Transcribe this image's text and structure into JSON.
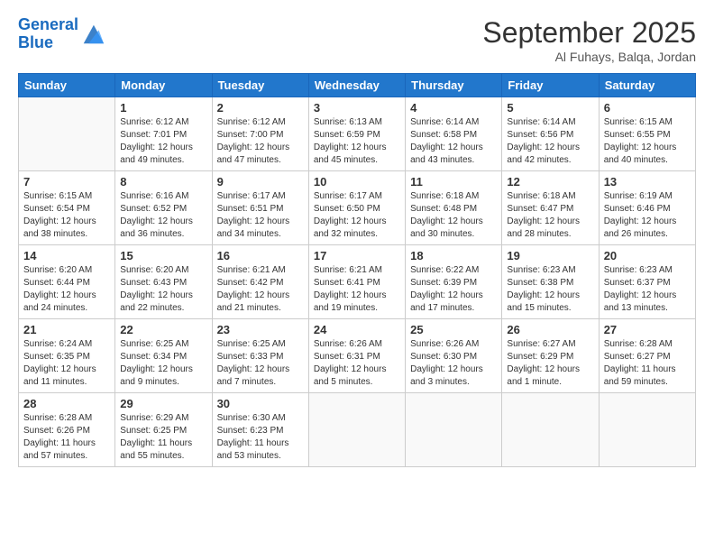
{
  "header": {
    "logo_line1": "General",
    "logo_line2": "Blue",
    "month_title": "September 2025",
    "location": "Al Fuhays, Balqa, Jordan"
  },
  "days_of_week": [
    "Sunday",
    "Monday",
    "Tuesday",
    "Wednesday",
    "Thursday",
    "Friday",
    "Saturday"
  ],
  "weeks": [
    [
      {
        "day": "",
        "info": ""
      },
      {
        "day": "1",
        "info": "Sunrise: 6:12 AM\nSunset: 7:01 PM\nDaylight: 12 hours\nand 49 minutes."
      },
      {
        "day": "2",
        "info": "Sunrise: 6:12 AM\nSunset: 7:00 PM\nDaylight: 12 hours\nand 47 minutes."
      },
      {
        "day": "3",
        "info": "Sunrise: 6:13 AM\nSunset: 6:59 PM\nDaylight: 12 hours\nand 45 minutes."
      },
      {
        "day": "4",
        "info": "Sunrise: 6:14 AM\nSunset: 6:58 PM\nDaylight: 12 hours\nand 43 minutes."
      },
      {
        "day": "5",
        "info": "Sunrise: 6:14 AM\nSunset: 6:56 PM\nDaylight: 12 hours\nand 42 minutes."
      },
      {
        "day": "6",
        "info": "Sunrise: 6:15 AM\nSunset: 6:55 PM\nDaylight: 12 hours\nand 40 minutes."
      }
    ],
    [
      {
        "day": "7",
        "info": "Sunrise: 6:15 AM\nSunset: 6:54 PM\nDaylight: 12 hours\nand 38 minutes."
      },
      {
        "day": "8",
        "info": "Sunrise: 6:16 AM\nSunset: 6:52 PM\nDaylight: 12 hours\nand 36 minutes."
      },
      {
        "day": "9",
        "info": "Sunrise: 6:17 AM\nSunset: 6:51 PM\nDaylight: 12 hours\nand 34 minutes."
      },
      {
        "day": "10",
        "info": "Sunrise: 6:17 AM\nSunset: 6:50 PM\nDaylight: 12 hours\nand 32 minutes."
      },
      {
        "day": "11",
        "info": "Sunrise: 6:18 AM\nSunset: 6:48 PM\nDaylight: 12 hours\nand 30 minutes."
      },
      {
        "day": "12",
        "info": "Sunrise: 6:18 AM\nSunset: 6:47 PM\nDaylight: 12 hours\nand 28 minutes."
      },
      {
        "day": "13",
        "info": "Sunrise: 6:19 AM\nSunset: 6:46 PM\nDaylight: 12 hours\nand 26 minutes."
      }
    ],
    [
      {
        "day": "14",
        "info": "Sunrise: 6:20 AM\nSunset: 6:44 PM\nDaylight: 12 hours\nand 24 minutes."
      },
      {
        "day": "15",
        "info": "Sunrise: 6:20 AM\nSunset: 6:43 PM\nDaylight: 12 hours\nand 22 minutes."
      },
      {
        "day": "16",
        "info": "Sunrise: 6:21 AM\nSunset: 6:42 PM\nDaylight: 12 hours\nand 21 minutes."
      },
      {
        "day": "17",
        "info": "Sunrise: 6:21 AM\nSunset: 6:41 PM\nDaylight: 12 hours\nand 19 minutes."
      },
      {
        "day": "18",
        "info": "Sunrise: 6:22 AM\nSunset: 6:39 PM\nDaylight: 12 hours\nand 17 minutes."
      },
      {
        "day": "19",
        "info": "Sunrise: 6:23 AM\nSunset: 6:38 PM\nDaylight: 12 hours\nand 15 minutes."
      },
      {
        "day": "20",
        "info": "Sunrise: 6:23 AM\nSunset: 6:37 PM\nDaylight: 12 hours\nand 13 minutes."
      }
    ],
    [
      {
        "day": "21",
        "info": "Sunrise: 6:24 AM\nSunset: 6:35 PM\nDaylight: 12 hours\nand 11 minutes."
      },
      {
        "day": "22",
        "info": "Sunrise: 6:25 AM\nSunset: 6:34 PM\nDaylight: 12 hours\nand 9 minutes."
      },
      {
        "day": "23",
        "info": "Sunrise: 6:25 AM\nSunset: 6:33 PM\nDaylight: 12 hours\nand 7 minutes."
      },
      {
        "day": "24",
        "info": "Sunrise: 6:26 AM\nSunset: 6:31 PM\nDaylight: 12 hours\nand 5 minutes."
      },
      {
        "day": "25",
        "info": "Sunrise: 6:26 AM\nSunset: 6:30 PM\nDaylight: 12 hours\nand 3 minutes."
      },
      {
        "day": "26",
        "info": "Sunrise: 6:27 AM\nSunset: 6:29 PM\nDaylight: 12 hours\nand 1 minute."
      },
      {
        "day": "27",
        "info": "Sunrise: 6:28 AM\nSunset: 6:27 PM\nDaylight: 11 hours\nand 59 minutes."
      }
    ],
    [
      {
        "day": "28",
        "info": "Sunrise: 6:28 AM\nSunset: 6:26 PM\nDaylight: 11 hours\nand 57 minutes."
      },
      {
        "day": "29",
        "info": "Sunrise: 6:29 AM\nSunset: 6:25 PM\nDaylight: 11 hours\nand 55 minutes."
      },
      {
        "day": "30",
        "info": "Sunrise: 6:30 AM\nSunset: 6:23 PM\nDaylight: 11 hours\nand 53 minutes."
      },
      {
        "day": "",
        "info": ""
      },
      {
        "day": "",
        "info": ""
      },
      {
        "day": "",
        "info": ""
      },
      {
        "day": "",
        "info": ""
      }
    ]
  ]
}
